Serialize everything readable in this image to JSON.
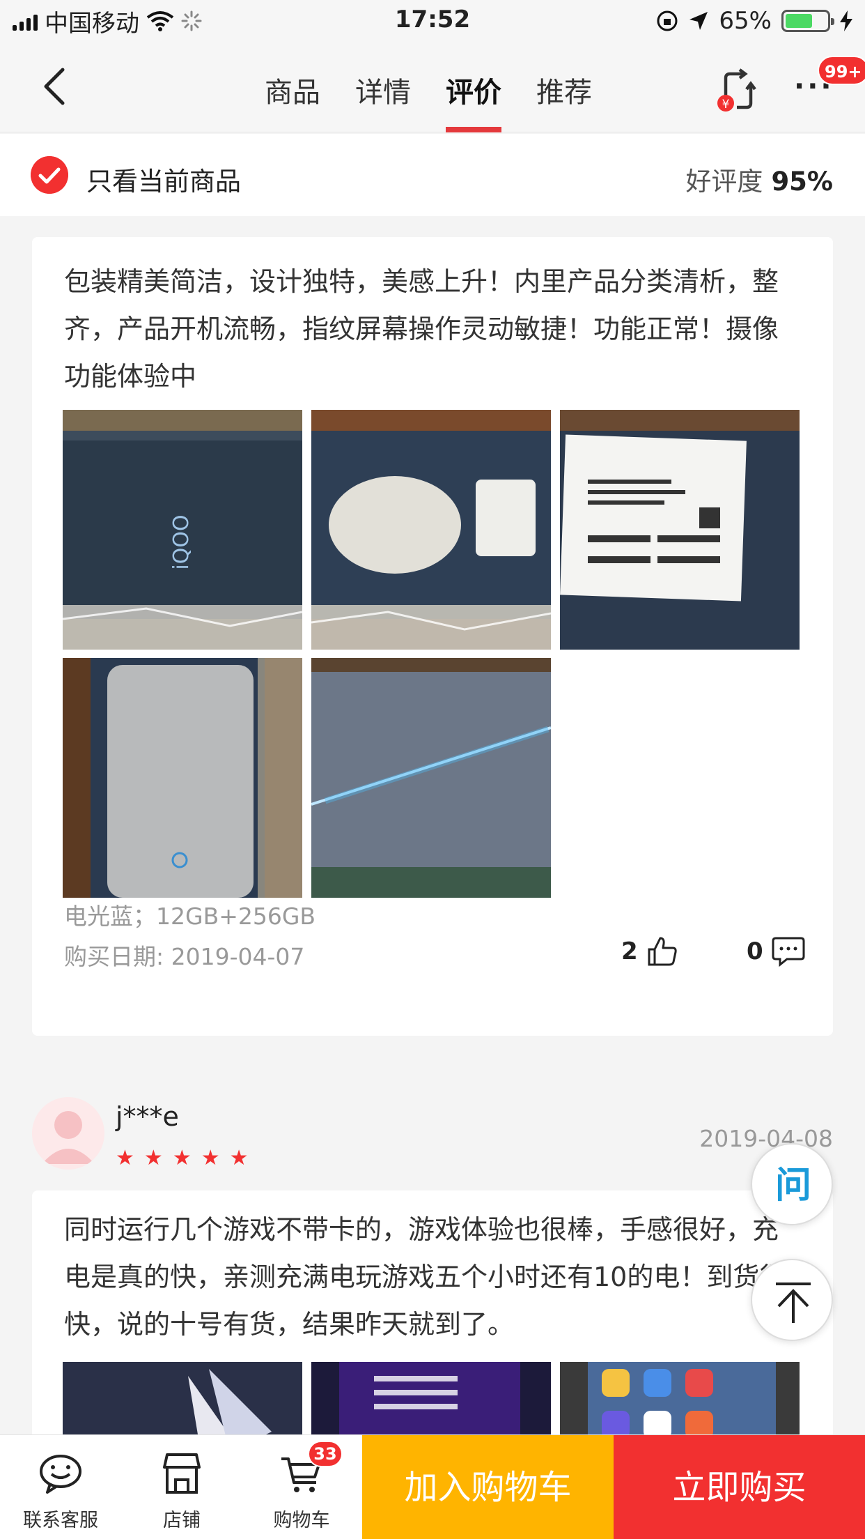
{
  "status_bar": {
    "carrier": "中国移动",
    "time": "17:52",
    "battery_percent": "65%",
    "battery_level": 0.65
  },
  "nav": {
    "tabs": [
      {
        "label": "商品",
        "active": false
      },
      {
        "label": "详情",
        "active": false
      },
      {
        "label": "评价",
        "active": true
      },
      {
        "label": "推荐",
        "active": false
      }
    ],
    "notification_badge": "99+"
  },
  "filter": {
    "label": "只看当前商品",
    "rating_label": "好评度",
    "rating_value": "95%"
  },
  "reviews": [
    {
      "text": "包装精美简洁，设计独特，美感上升！内里产品分类清析，整齐，产品开机流畅，指纹屏幕操作灵动敏捷！功能正常！摄像功能体验中",
      "variant": "电光蓝；12GB+256GB",
      "purchase_date": "购买日期: 2019-04-07",
      "likes": "2",
      "comments": "0"
    },
    {
      "username": "j***e",
      "rating": 5,
      "date": "2019-04-08",
      "text": "同时运行几个游戏不带卡的，游戏体验也很棒，手感很好，充电是真的快，亲测充满电玩游戏五个小时还有10的电！到货很快，说的十号有货，结果昨天就到了。"
    }
  ],
  "floating": {
    "ask_label": "问"
  },
  "bottom_bar": {
    "service_label": "联系客服",
    "shop_label": "店铺",
    "cart_label": "购物车",
    "cart_count": "33",
    "add_to_cart": "加入购物车",
    "buy_now": "立即购买"
  },
  "colors": {
    "accent_red": "#f23030",
    "cart_yellow": "#ffb400"
  }
}
